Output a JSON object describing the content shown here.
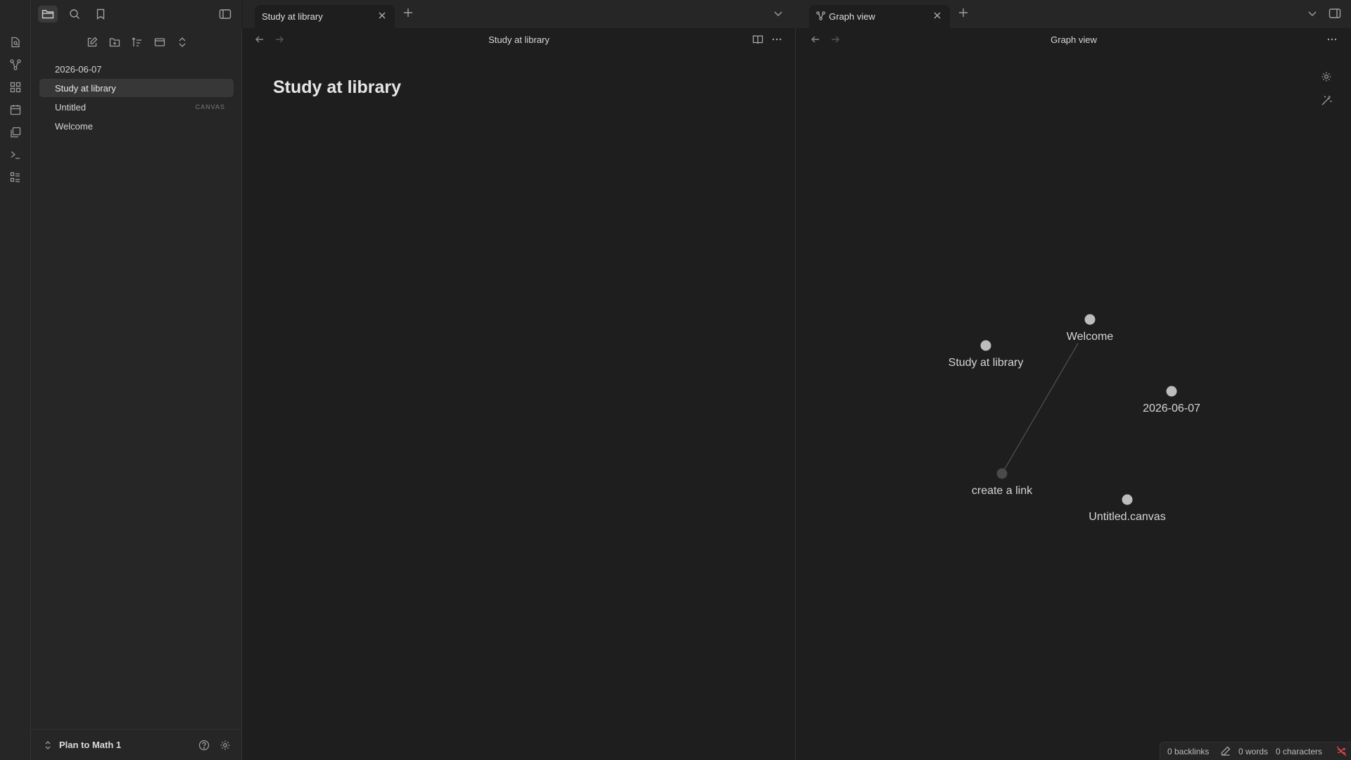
{
  "sidebar": {
    "files": [
      {
        "name": "2026-06-07",
        "tag": ""
      },
      {
        "name": "Study at library",
        "tag": ""
      },
      {
        "name": "Untitled",
        "tag": "CANVAS"
      },
      {
        "name": "Welcome",
        "tag": ""
      }
    ],
    "vault_name": "Plan to Math 1"
  },
  "left_pane": {
    "tab_title": "Study at library",
    "header_title": "Study at library",
    "note_title": "Study at library"
  },
  "right_pane": {
    "tab_title": "Graph view",
    "header_title": "Graph view",
    "graph": {
      "nodes": [
        {
          "label": "Welcome"
        },
        {
          "label": "Study at library"
        },
        {
          "label": "2026-06-07"
        },
        {
          "label": "create a link"
        },
        {
          "label": "Untitled.canvas"
        }
      ],
      "edges": [
        [
          "Welcome",
          "create a link"
        ]
      ]
    }
  },
  "status_bar": {
    "backlinks": "0 backlinks",
    "words": "0 words",
    "characters": "0 characters"
  },
  "colors": {
    "background": "#1e1e1e",
    "panel": "#262626",
    "node": "#bdbdbd",
    "unresolved_node": "#4a4a4a",
    "sync_error": "#e0454a"
  }
}
